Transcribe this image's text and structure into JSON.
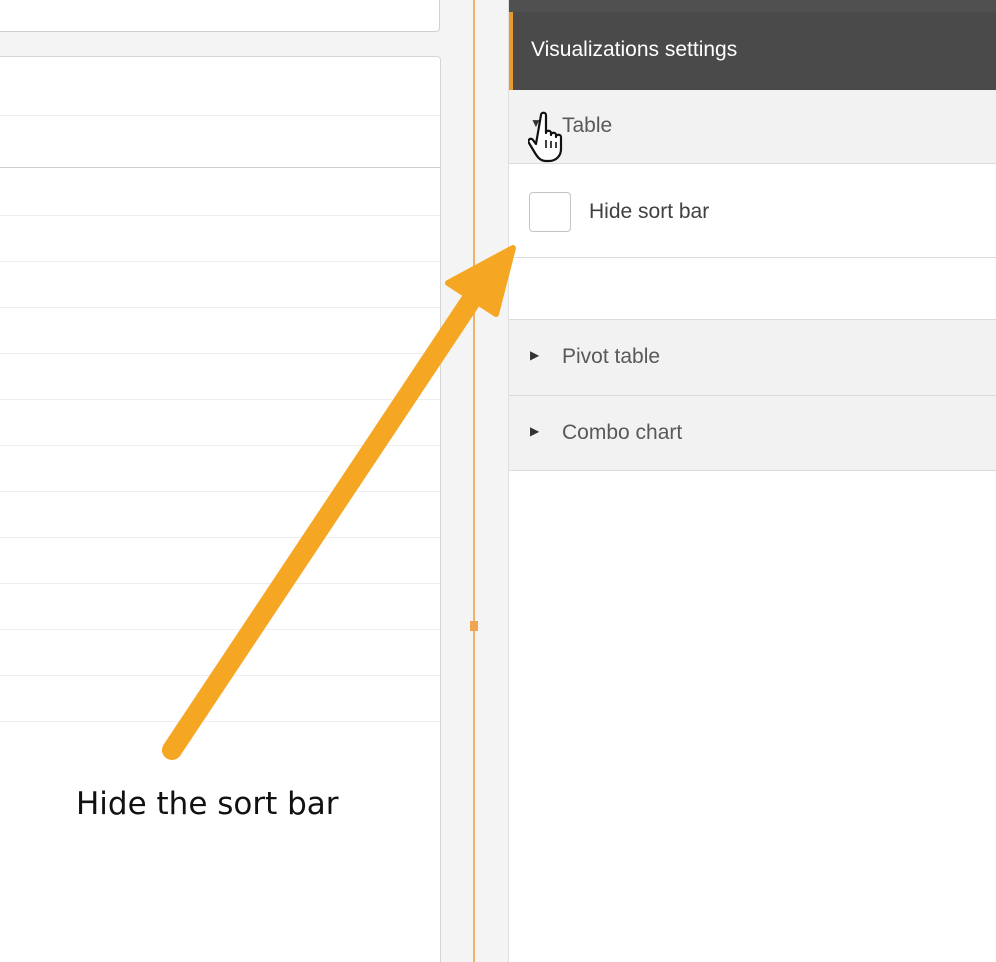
{
  "annotation": {
    "text": "Hide the sort bar",
    "arrow_color": "#f5a623"
  },
  "settings_panel": {
    "title": "Visualizations settings",
    "accent_color": "#e89a30",
    "sections": [
      {
        "label": "Table",
        "expanded": true,
        "caret_icon": "triangle-down-icon"
      },
      {
        "label": "Pivot table",
        "expanded": false,
        "caret_icon": "triangle-right-icon"
      },
      {
        "label": "Combo chart",
        "expanded": false,
        "caret_icon": "triangle-right-icon"
      }
    ],
    "table_options": {
      "hide_sort_bar": {
        "label": "Hide sort bar",
        "checked": false
      }
    }
  },
  "cursor": {
    "icon": "hand-pointer-icon"
  },
  "splitter": {
    "color": "#f0b169"
  }
}
